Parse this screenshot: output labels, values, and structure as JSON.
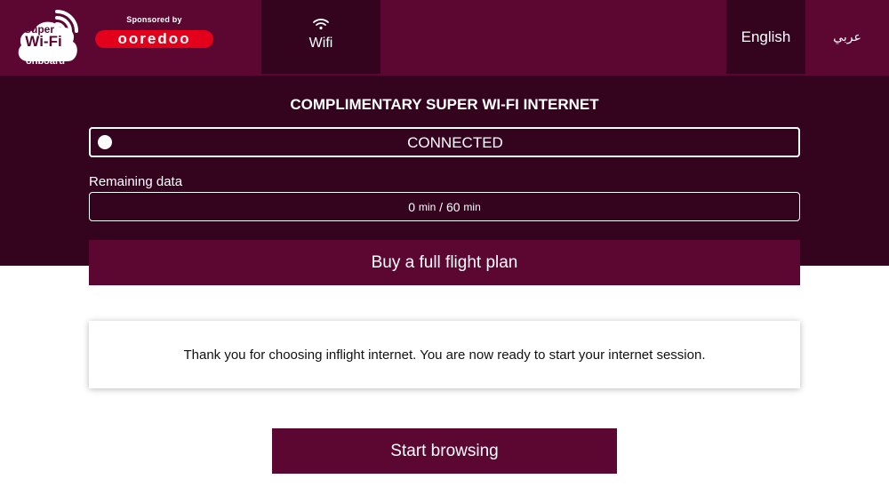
{
  "header": {
    "logo": {
      "line1": "Super",
      "line2": "Wi-Fi",
      "line3": "onboard",
      "icon": "wifi-cloud-logo"
    },
    "sponsor": {
      "label": "Sponsored by",
      "brand": "ooredoo",
      "brand_color": "#e2001a"
    },
    "wifi_tab": {
      "label": "Wifi",
      "icon": "wifi-icon"
    },
    "languages": {
      "english": "English",
      "arabic": "عربي"
    }
  },
  "status": {
    "title": "COMPLIMENTARY SUPER WI-FI INTERNET",
    "connection": "CONNECTED",
    "remaining_label": "Remaining data",
    "remaining_used": "0",
    "remaining_total": "60",
    "unit": "min",
    "separator": "/"
  },
  "actions": {
    "buy_plan": "Buy a full flight plan",
    "start_browsing": "Start browsing"
  },
  "message": "Thank you for choosing inflight internet. You are now ready to start your internet session.",
  "colors": {
    "brand": "#5c0632",
    "dark": "#34041f"
  }
}
